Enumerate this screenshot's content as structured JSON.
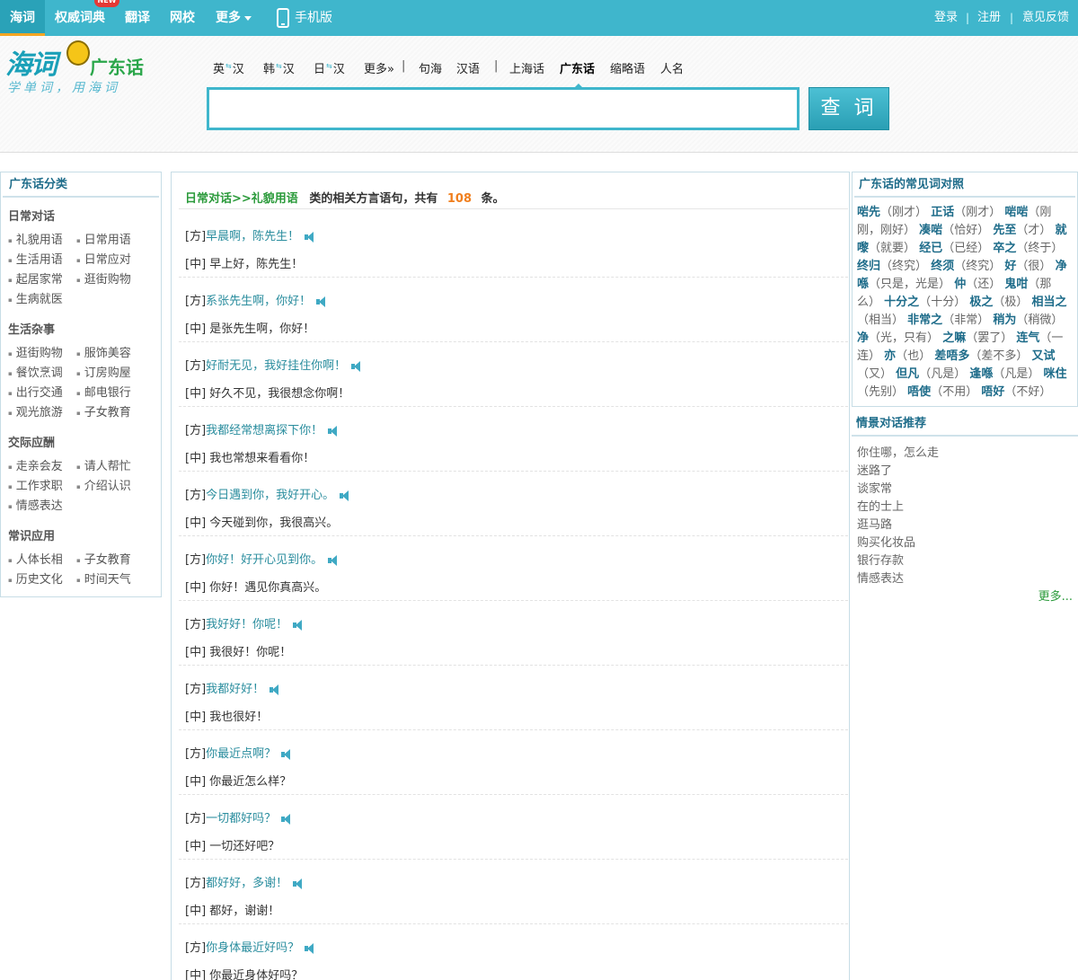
{
  "topnav": {
    "items": [
      "海词",
      "权威词典",
      "翻译",
      "网校",
      "更多"
    ],
    "new_badge": "NEW",
    "mobile": "手机版",
    "login": "登录",
    "register": "注册",
    "feedback": "意见反馈",
    "separator": "|"
  },
  "logo": {
    "brand": "海词",
    "sub": "广东话",
    "slogan": "学单词，用海词"
  },
  "dict_tabs": {
    "en": "英",
    "han": "汉",
    "ko": "韩",
    "ja": "日",
    "more": "更多»",
    "sep": "|",
    "juhai": "句海",
    "hanyu": "汉语",
    "shanghai": "上海话",
    "cantonese": "广东话",
    "abbr": "缩略语",
    "names": "人名",
    "arrows": "⇆"
  },
  "search": {
    "value": "",
    "button": "查 词"
  },
  "left": {
    "title": "广东话分类",
    "groups": [
      {
        "heading": "日常对话",
        "links": [
          "礼貌用语",
          "日常用语",
          "生活用语",
          "日常应对",
          "起居家常",
          "逛街购物",
          "生病就医"
        ]
      },
      {
        "heading": "生活杂事",
        "links": [
          "逛街购物",
          "服饰美容",
          "餐饮烹调",
          "订房购屋",
          "出行交通",
          "邮电银行",
          "观光旅游",
          "子女教育"
        ]
      },
      {
        "heading": "交际应酬",
        "links": [
          "走亲会友",
          "请人帮忙",
          "工作求职",
          "介绍认识",
          "情感表达"
        ]
      },
      {
        "heading": "常识应用",
        "links": [
          "人体长相",
          "子女教育",
          "历史文化",
          "时间天气"
        ]
      }
    ]
  },
  "main": {
    "crumb": "日常对话>>礼貌用语",
    "summary_mid": "类的相关方言语句，共有",
    "count": "108",
    "summary_end": "条。",
    "fang_prefix": "[方]",
    "zhong_prefix": "[中]",
    "entries": [
      {
        "fang": "早晨啊，陈先生！",
        "zhong": "早上好，陈先生！"
      },
      {
        "fang": "系张先生啊，你好！",
        "zhong": "是张先生啊，你好！"
      },
      {
        "fang": "好耐无见，我好挂住你啊！",
        "zhong": "好久不见，我很想念你啊！"
      },
      {
        "fang": "我都经常想离探下你！",
        "zhong": "我也常想来看看你！"
      },
      {
        "fang": "今日遇到你，我好开心。",
        "zhong": "今天碰到你，我很高兴。"
      },
      {
        "fang": "你好！好开心见到你。",
        "zhong": "你好！遇见你真高兴。"
      },
      {
        "fang": "我好好！你呢！",
        "zhong": "我很好！你呢！"
      },
      {
        "fang": "我都好好！",
        "zhong": "我也很好！"
      },
      {
        "fang": "你最近点啊？",
        "zhong": "你最近怎么样？"
      },
      {
        "fang": "一切都好吗？",
        "zhong": "一切还好吧？"
      },
      {
        "fang": "都好好，多谢！",
        "zhong": "都好，谢谢！"
      },
      {
        "fang": "你身体最近好吗？",
        "zhong": "你最近身体好吗？"
      }
    ]
  },
  "right": {
    "title": "广东话的常见词对照",
    "pairs": [
      {
        "term": "啱先",
        "gloss": "刚才"
      },
      {
        "term": "正话",
        "gloss": "刚才"
      },
      {
        "term": "啱啱",
        "gloss": "刚刚，刚好"
      },
      {
        "term": "凑啱",
        "gloss": "恰好"
      },
      {
        "term": "先至",
        "gloss": "才"
      },
      {
        "term": "就嚟",
        "gloss": "就要"
      },
      {
        "term": "经已",
        "gloss": "已经"
      },
      {
        "term": "卒之",
        "gloss": "终于"
      },
      {
        "term": "终归",
        "gloss": "终究"
      },
      {
        "term": "终须",
        "gloss": "终究"
      },
      {
        "term": "好",
        "gloss": "很"
      },
      {
        "term": "净喺",
        "gloss": "只是，光是"
      },
      {
        "term": "仲",
        "gloss": "还"
      },
      {
        "term": "鬼咁",
        "gloss": "那么"
      },
      {
        "term": "十分之",
        "gloss": "十分"
      },
      {
        "term": "极之",
        "gloss": "极"
      },
      {
        "term": "相当之",
        "gloss": "相当"
      },
      {
        "term": "非常之",
        "gloss": "非常"
      },
      {
        "term": "稍为",
        "gloss": "稍微"
      },
      {
        "term": "净",
        "gloss": "光，只有"
      },
      {
        "term": "之嘛",
        "gloss": "罢了"
      },
      {
        "term": "连气",
        "gloss": "一连"
      },
      {
        "term": "亦",
        "gloss": "也"
      },
      {
        "term": "差唔多",
        "gloss": "差不多"
      },
      {
        "term": "又试",
        "gloss": "又"
      },
      {
        "term": "但凡",
        "gloss": "凡是"
      },
      {
        "term": "逢喺",
        "gloss": "凡是"
      },
      {
        "term": "咪住",
        "gloss": "先别"
      },
      {
        "term": "唔使",
        "gloss": "不用"
      },
      {
        "term": "唔好",
        "gloss": "不好"
      }
    ],
    "rec_title": "情景对话推荐",
    "rec_links": [
      "你住哪，怎么走",
      "迷路了",
      "谈家常",
      "在的士上",
      "逛马路",
      "购买化妆品",
      "银行存款",
      "情感表达"
    ],
    "more": "更多..."
  }
}
